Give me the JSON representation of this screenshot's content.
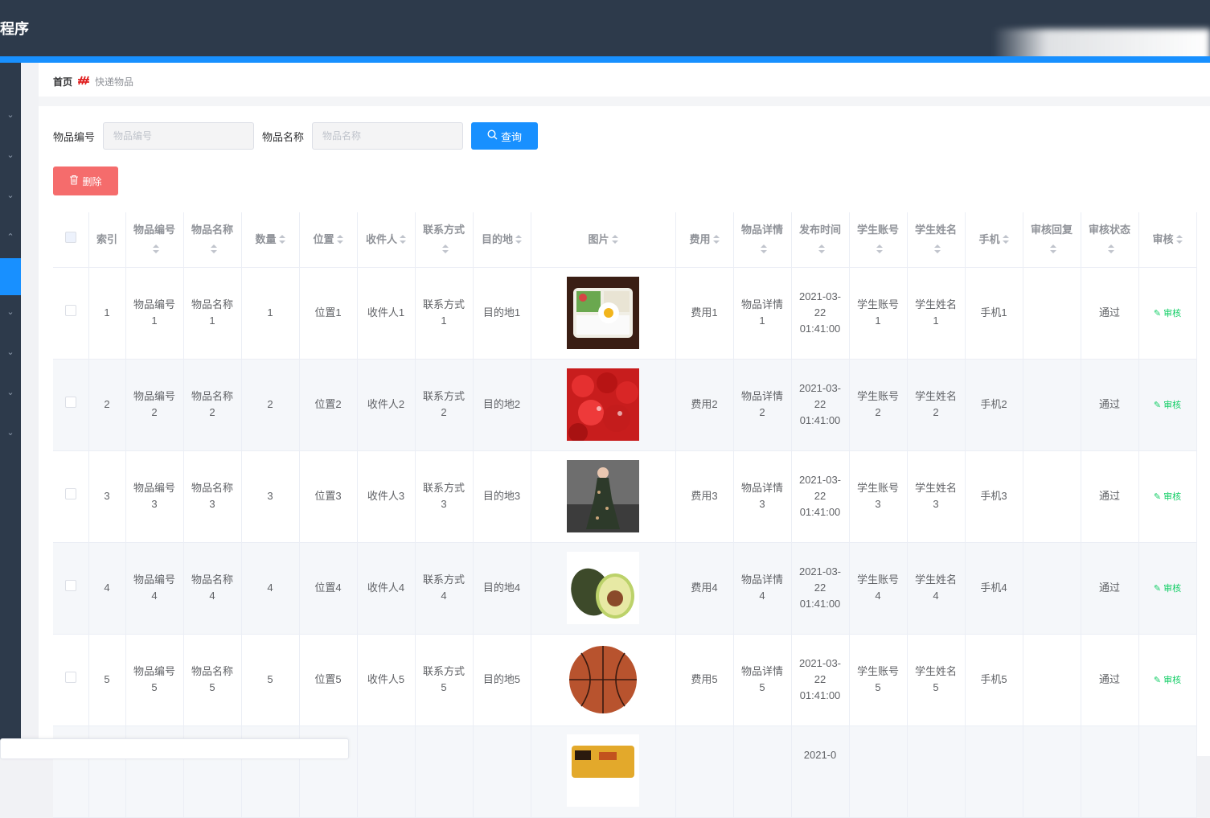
{
  "app": {
    "title_fragment": "程序"
  },
  "breadcrumb": {
    "home": "首页",
    "icon": "ornament-icon",
    "current": "快递物品"
  },
  "search": {
    "item_no_label": "物品编号",
    "item_no_placeholder": "物品编号",
    "item_name_label": "物品名称",
    "item_name_placeholder": "物品名称",
    "query_label": "查询",
    "query_icon": "search-icon"
  },
  "actions": {
    "delete_label": "删除",
    "delete_icon": "trash-icon"
  },
  "colors": {
    "topbar": "#2d3a4b",
    "accent": "#1890ff",
    "danger": "#f56c6c",
    "success": "#13ce66"
  },
  "table": {
    "headers": [
      "索引",
      "物品编号",
      "物品名称",
      "数量",
      "位置",
      "收件人",
      "联系方式",
      "目的地",
      "图片",
      "费用",
      "物品详情",
      "发布时间",
      "学生账号",
      "学生姓名",
      "手机",
      "审核回复",
      "审核状态",
      "审核"
    ],
    "rows": [
      {
        "index": "1",
        "item_no": "物品编号1",
        "item_name": "物品名称1",
        "qty": "1",
        "location": "位置1",
        "recipient": "收件人1",
        "contact": "联系方式1",
        "destination": "目的地1",
        "image": "bento-lunch-photo",
        "fee": "费用1",
        "detail": "物品详情1",
        "time": "2021-03-22 01:41:00",
        "student_account": "学生账号1",
        "student_name": "学生姓名1",
        "phone": "手机1",
        "reply": "",
        "status": "通过",
        "audit": "审核"
      },
      {
        "index": "2",
        "item_no": "物品编号2",
        "item_name": "物品名称2",
        "qty": "2",
        "location": "位置2",
        "recipient": "收件人2",
        "contact": "联系方式2",
        "destination": "目的地2",
        "image": "cherries-photo",
        "fee": "费用2",
        "detail": "物品详情2",
        "time": "2021-03-22 01:41:00",
        "student_account": "学生账号2",
        "student_name": "学生姓名2",
        "phone": "手机2",
        "reply": "",
        "status": "通过",
        "audit": "审核"
      },
      {
        "index": "3",
        "item_no": "物品编号3",
        "item_name": "物品名称3",
        "qty": "3",
        "location": "位置3",
        "recipient": "收件人3",
        "contact": "联系方式3",
        "destination": "目的地3",
        "image": "woman-in-dress-photo",
        "fee": "费用3",
        "detail": "物品详情3",
        "time": "2021-03-22 01:41:00",
        "student_account": "学生账号3",
        "student_name": "学生姓名3",
        "phone": "手机3",
        "reply": "",
        "status": "通过",
        "audit": "审核"
      },
      {
        "index": "4",
        "item_no": "物品编号4",
        "item_name": "物品名称4",
        "qty": "4",
        "location": "位置4",
        "recipient": "收件人4",
        "contact": "联系方式4",
        "destination": "目的地4",
        "image": "avocado-photo",
        "fee": "费用4",
        "detail": "物品详情4",
        "time": "2021-03-22 01:41:00",
        "student_account": "学生账号4",
        "student_name": "学生姓名4",
        "phone": "手机4",
        "reply": "",
        "status": "通过",
        "audit": "审核"
      },
      {
        "index": "5",
        "item_no": "物品编号5",
        "item_name": "物品名称5",
        "qty": "5",
        "location": "位置5",
        "recipient": "收件人5",
        "contact": "联系方式5",
        "destination": "目的地5",
        "image": "basketball-photo",
        "fee": "费用5",
        "detail": "物品详情5",
        "time": "2021-03-22 01:41:00",
        "student_account": "学生账号5",
        "student_name": "学生姓名5",
        "phone": "手机5",
        "reply": "",
        "status": "通过",
        "audit": "审核"
      },
      {
        "time": "2021-0",
        "image": "food-photo"
      }
    ]
  }
}
